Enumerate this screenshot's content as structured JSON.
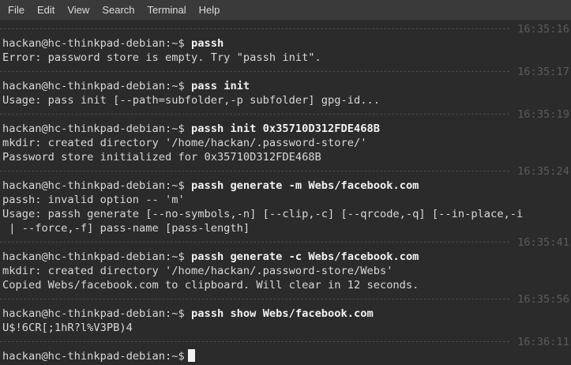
{
  "menu": {
    "items": [
      "File",
      "Edit",
      "View",
      "Search",
      "Terminal",
      "Help"
    ]
  },
  "prompt": "hackan@hc-thinkpad-debian:~$",
  "blocks": [
    {
      "time": "16:35:16",
      "command": "passh",
      "output": [
        "Error: password store is empty. Try \"passh init\"."
      ]
    },
    {
      "time": "16:35:17",
      "command": "pass init",
      "output": [
        "Usage: pass init [--path=subfolder,-p subfolder] gpg-id..."
      ]
    },
    {
      "time": "16:35:19",
      "command": "passh init 0x35710D312FDE468B",
      "output": [
        "mkdir: created directory '/home/hackan/.password-store/'",
        "Password store initialized for 0x35710D312FDE468B"
      ]
    },
    {
      "time": "16:35:24",
      "command": "passh generate -m Webs/facebook.com",
      "output": [
        "passh: invalid option -- 'm'",
        "Usage: passh generate [--no-symbols,-n] [--clip,-c] [--qrcode,-q] [--in-place,-i",
        " | --force,-f] pass-name [pass-length]"
      ]
    },
    {
      "time": "16:35:41",
      "command": "passh generate -c Webs/facebook.com",
      "output": [
        "mkdir: created directory '/home/hackan/.password-store/Webs'",
        "Copied Webs/facebook.com to clipboard. Will clear in 12 seconds."
      ]
    },
    {
      "time": "16:35:56",
      "command": "passh show Webs/facebook.com",
      "output": [
        "U$!6CR[;1hR?l%V3PB)4"
      ]
    },
    {
      "time": "16:36:11",
      "command": "",
      "output": []
    }
  ]
}
